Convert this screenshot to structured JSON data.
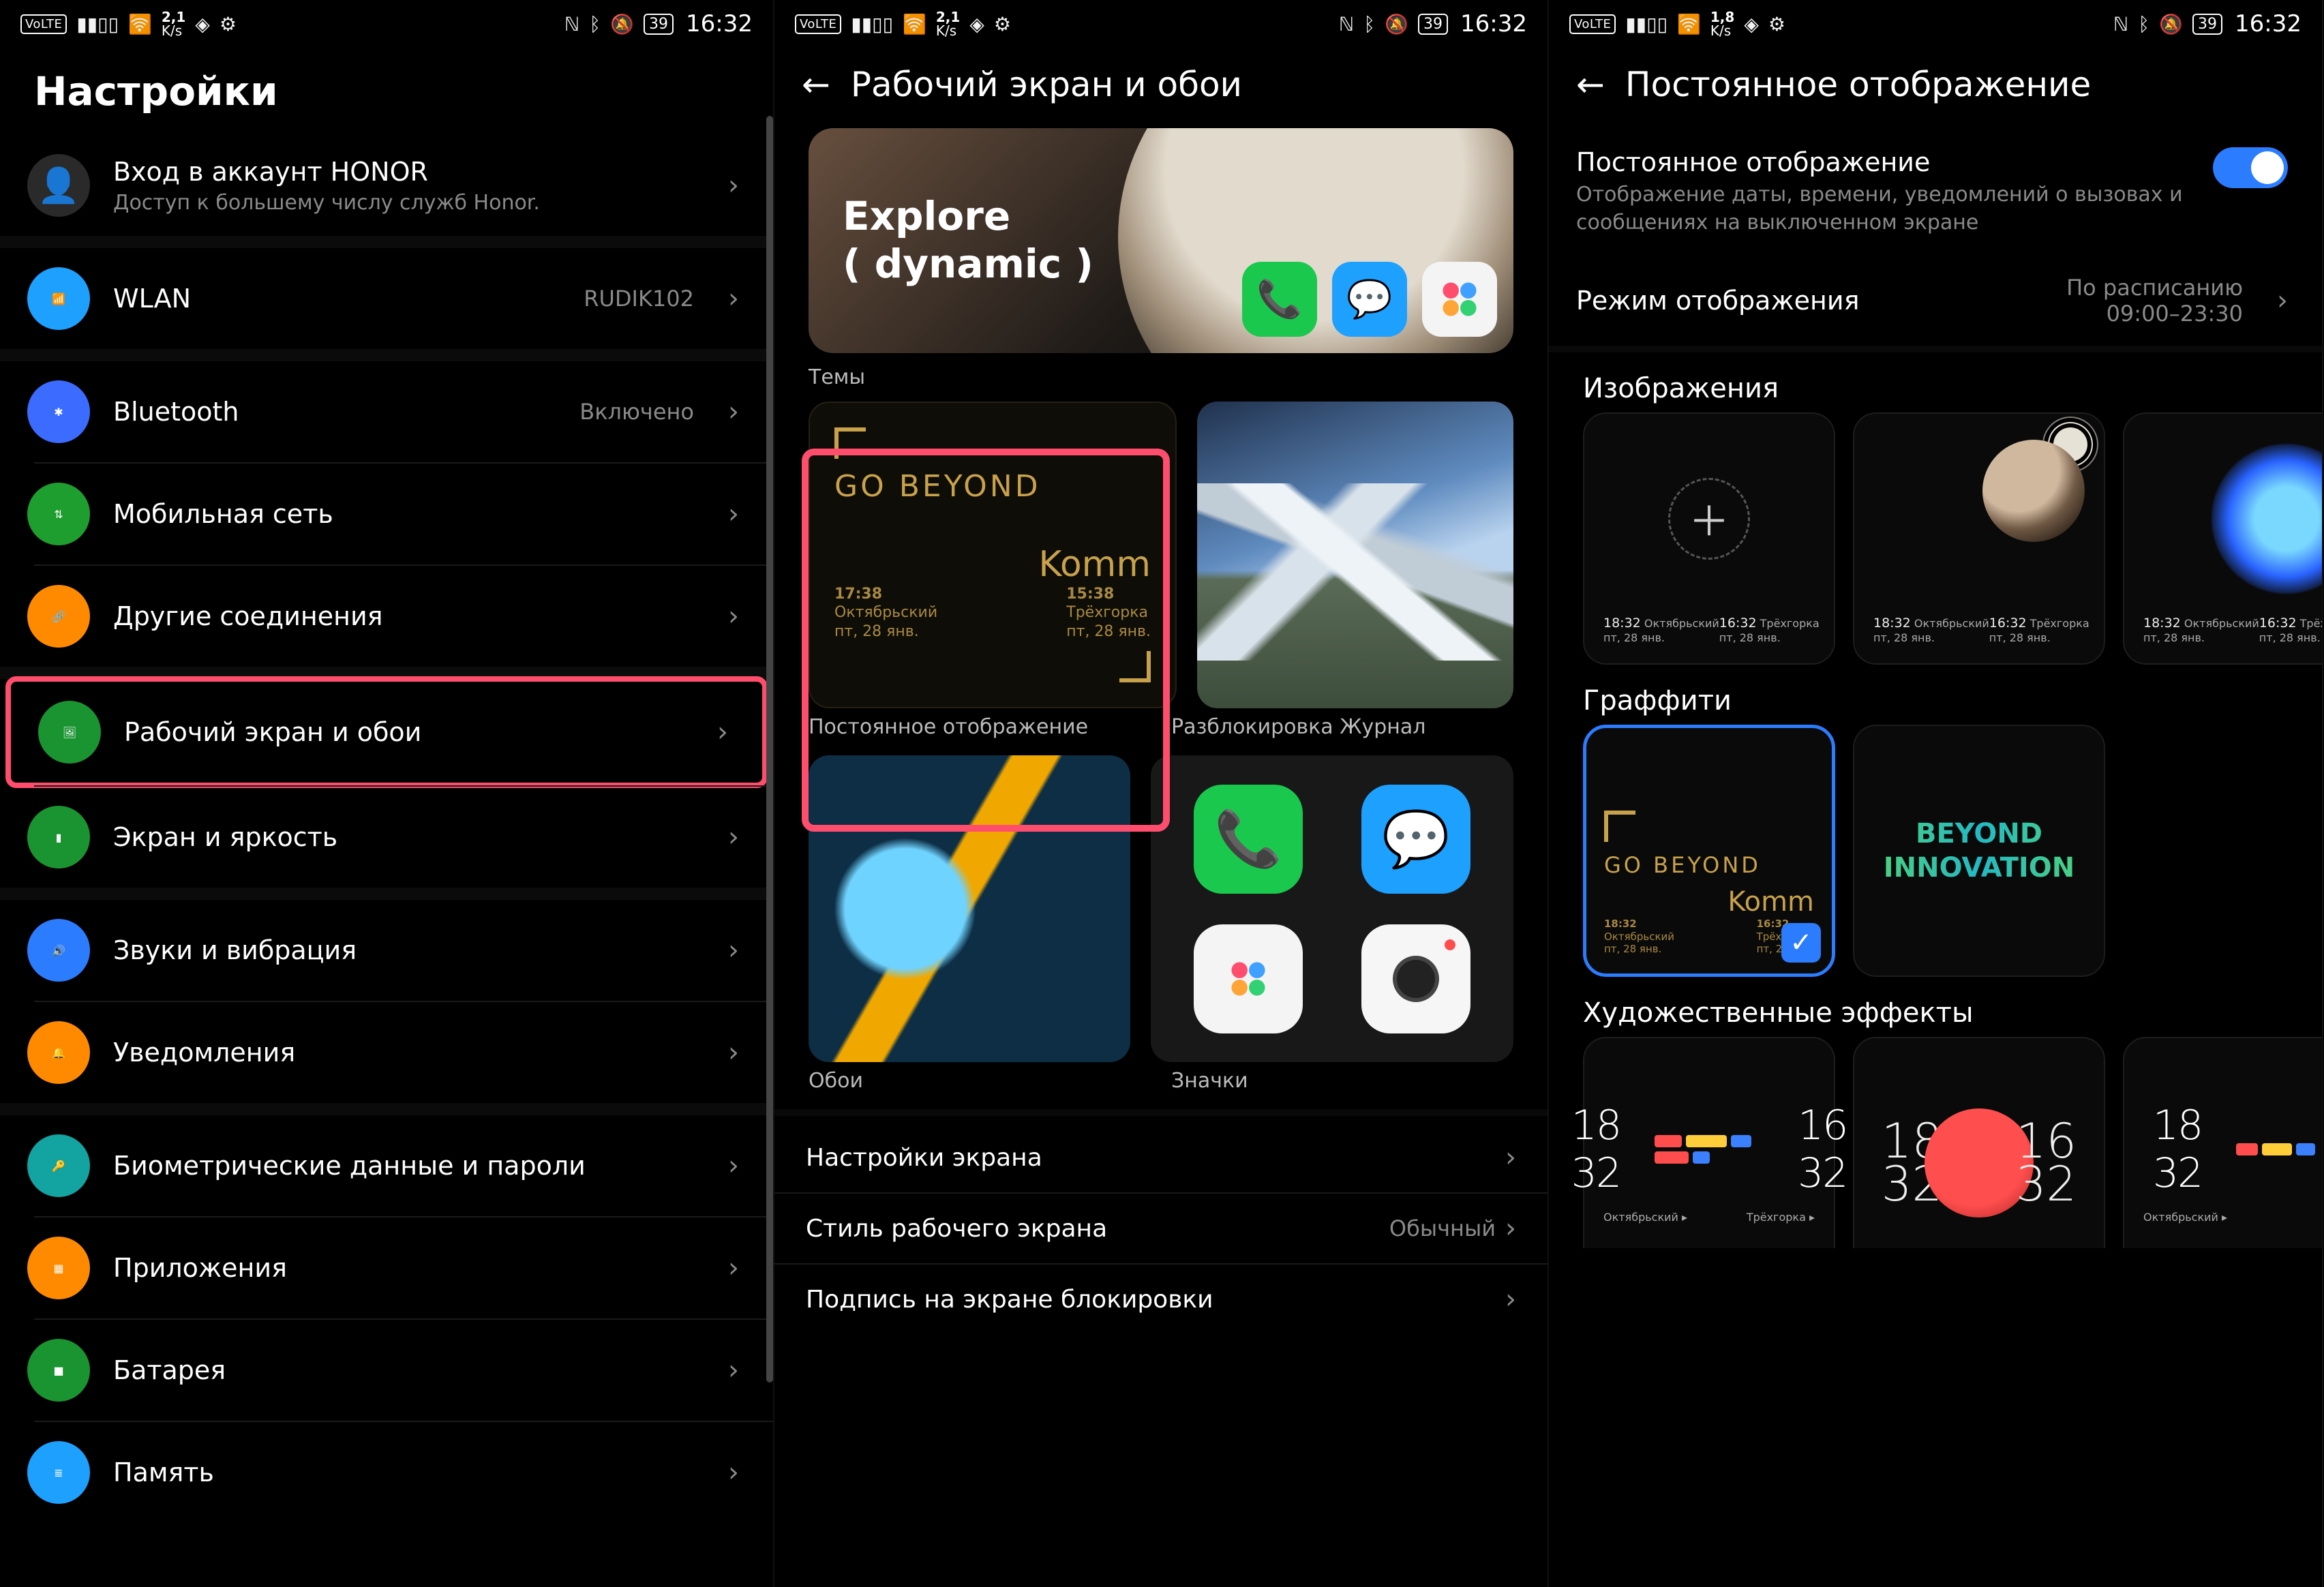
{
  "status": {
    "volte": "VoLTE",
    "kps1": "2,1",
    "kps2": "K/s",
    "kps1_alt": "1,8",
    "battery": "39",
    "time": "16:32"
  },
  "pane1": {
    "title": "Настройки",
    "account_icon": "person-icon",
    "account_title": "Вход в аккаунт HONOR",
    "account_sub": "Доступ к большему числу служб Honor.",
    "items": [
      {
        "icon": "wifi-icon",
        "color": "#1ea0ff",
        "glyph": "📶",
        "label": "WLAN",
        "value": "RUDIK102"
      },
      {
        "icon": "bluetooth-icon",
        "color": "#3b6bff",
        "glyph": "✱",
        "label": "Bluetooth",
        "value": "Включено"
      },
      {
        "icon": "mobile-data-icon",
        "color": "#1e9e2f",
        "glyph": "⇅",
        "label": "Мобильная сеть",
        "value": ""
      },
      {
        "icon": "link-icon",
        "color": "#ff8a00",
        "glyph": "🔗",
        "label": "Другие соединения",
        "value": ""
      },
      {
        "icon": "wallpaper-icon",
        "color": "#1a9431",
        "glyph": "🖼",
        "label": "Рабочий экран и обои",
        "value": "",
        "highlight": true
      },
      {
        "icon": "display-icon",
        "color": "#1a9431",
        "glyph": "▮",
        "label": "Экран и яркость",
        "value": ""
      },
      {
        "icon": "sound-icon",
        "color": "#2b7cff",
        "glyph": "🔊",
        "label": "Звуки и вибрация",
        "value": ""
      },
      {
        "icon": "notifications-icon",
        "color": "#ff8a00",
        "glyph": "🔔",
        "label": "Уведомления",
        "value": ""
      },
      {
        "icon": "biometrics-icon",
        "color": "#13a3a0",
        "glyph": "🔑",
        "label": "Биометрические данные и пароли",
        "value": ""
      },
      {
        "icon": "apps-icon",
        "color": "#ff8a00",
        "glyph": "▦",
        "label": "Приложения",
        "value": ""
      },
      {
        "icon": "battery-icon",
        "color": "#1a9431",
        "glyph": "■",
        "label": "Батарея",
        "value": ""
      },
      {
        "icon": "storage-icon",
        "color": "#1ea0ff",
        "glyph": "≣",
        "label": "Память",
        "value": ""
      }
    ]
  },
  "pane2": {
    "title": "Рабочий экран и обои",
    "hero_line1": "Explore",
    "hero_line2": "( dynamic )",
    "hero_caption": "Темы",
    "go_beyond": {
      "title": "GO BEYOND",
      "komm": "Komm",
      "left_time": "17:38",
      "left_city": "Октябрьский",
      "left_date": "пт, 28 янв.",
      "right_time": "15:38",
      "right_city": "Трёхгорка",
      "right_date": "пт, 28 янв."
    },
    "card_aod_label": "Постоянное отображение",
    "card_magazine_label": "Разблокировка Журнал",
    "card_wallpapers_label": "Обои",
    "card_icons_label": "Значки",
    "menu": [
      {
        "label": "Настройки экрана",
        "value": ""
      },
      {
        "label": "Стиль рабочего экрана",
        "value": "Обычный"
      },
      {
        "label": "Подпись на экране блокировки",
        "value": ""
      }
    ]
  },
  "pane3": {
    "title": "Постоянное отображение",
    "toggle_title": "Постоянное отображение",
    "toggle_desc": "Отображение даты, времени, уведомлений о вызовах и сообщениях на выключенном экране",
    "mode_label": "Режим отображения",
    "mode_value": "По расписанию",
    "mode_time": "09:00–23:30",
    "section_images": "Изображения",
    "section_graffiti": "Граффити",
    "section_art": "Художественные эффекты",
    "beyond_innovation_l1": "BEYOND",
    "beyond_innovation_l2": "INNOVATION",
    "aod_times": {
      "left_time": "18:32",
      "left_city": "Октябрьский",
      "left_date": "пт, 28 янв.",
      "right_time": "16:32",
      "right_city": "Трёхгорка",
      "right_date": "пт, 28 янв."
    },
    "go_beyond2_title": "GO BEYOND",
    "go_beyond2_komm": "Komm",
    "art_time_left": "18\n32",
    "art_time_right": "16\n32",
    "art_city_left": "Октябрьский",
    "art_city_right": "Трёхгорка"
  }
}
